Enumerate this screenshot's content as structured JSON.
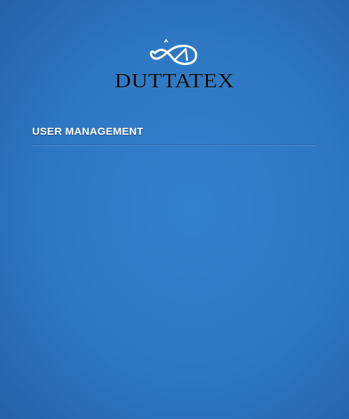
{
  "brand": {
    "name": "DUTTATEX",
    "logo_icon": "duttatex-logo-icon"
  },
  "section": {
    "title": "USER MANAGEMENT"
  },
  "colors": {
    "background": "#2f7bc6",
    "title_text": "#ffffff",
    "brand_text": "#0a0a0a",
    "divider": "#1f5fa8"
  }
}
